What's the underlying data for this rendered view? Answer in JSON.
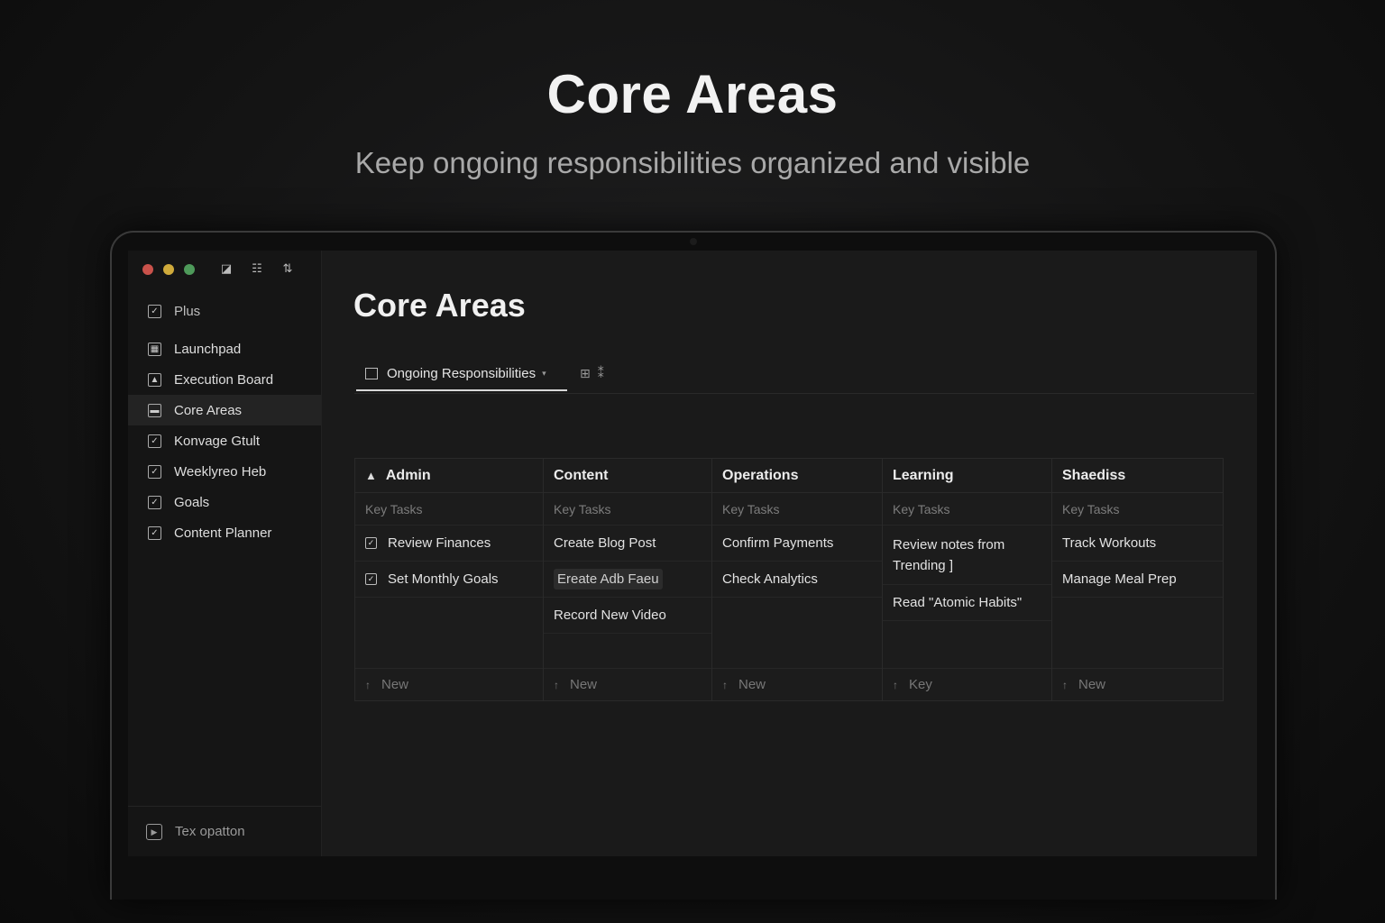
{
  "hero": {
    "title": "Core Areas",
    "subtitle": "Keep ongoing responsibilities organized and visible"
  },
  "window": {
    "toolbar_icons": [
      "inbox-icon",
      "list-icon",
      "sort-icon"
    ],
    "toolbar_glyphs": [
      "◪",
      "☷",
      "⇅"
    ]
  },
  "sidebar": {
    "items": [
      {
        "label": "Plus",
        "icon": "checkbox-icon",
        "glyph": "✓"
      },
      {
        "label": "Launchpad",
        "icon": "launchpad-icon",
        "glyph": "▦"
      },
      {
        "label": "Execution Board",
        "icon": "chart-icon",
        "glyph": "▲"
      },
      {
        "label": "Core Areas",
        "icon": "calendar-icon",
        "glyph": "▬"
      },
      {
        "label": "Konvage Gtult",
        "icon": "checkbox-icon",
        "glyph": "✓"
      },
      {
        "label": "Weeklyreo Heb",
        "icon": "checkbox-icon",
        "glyph": "✓"
      },
      {
        "label": "Goals",
        "icon": "checkbox-icon",
        "glyph": "✓"
      },
      {
        "label": "Content Planner",
        "icon": "checkbox-icon",
        "glyph": "✓"
      }
    ],
    "footer_label": "Tex opatton",
    "footer_icon": "play-icon"
  },
  "main": {
    "title": "Core Areas",
    "view_tab": "Ongoing Responsibilities",
    "view_icons": [
      "lock-icon",
      "shuffle-icon"
    ],
    "view_glyphs": [
      "⊞",
      "⁑"
    ]
  },
  "board": {
    "columns": [
      {
        "title": "Admin",
        "icon": "person-icon",
        "subheader": "Key Tasks",
        "rows": [
          {
            "text": "Review Finances",
            "checkbox": true
          },
          {
            "text": "Set Monthly Goals",
            "checkbox": true
          }
        ],
        "footer": "New"
      },
      {
        "title": "Content",
        "subheader": "Key Tasks",
        "rows": [
          {
            "text": "Create Blog Post"
          },
          {
            "text": "Ereate Adb Faeu",
            "highlight": true
          },
          {
            "text": "Record New Video"
          }
        ],
        "footer": "New"
      },
      {
        "title": "Operations",
        "subheader": "Key Tasks",
        "rows": [
          {
            "text": "Confirm Payments"
          },
          {
            "text": "Check Analytics"
          }
        ],
        "footer": "New"
      },
      {
        "title": "Learning",
        "subheader": "Key Tasks",
        "rows": [
          {
            "text": "Review notes from Trending ]"
          },
          {
            "text": "Read \"Atomic Habits\""
          }
        ],
        "footer": "Key"
      },
      {
        "title": "Shaediss",
        "subheader": "Key Tasks",
        "rows": [
          {
            "text": "Track Workouts"
          },
          {
            "text": "Manage Meal Prep"
          }
        ],
        "footer": "New"
      }
    ]
  }
}
